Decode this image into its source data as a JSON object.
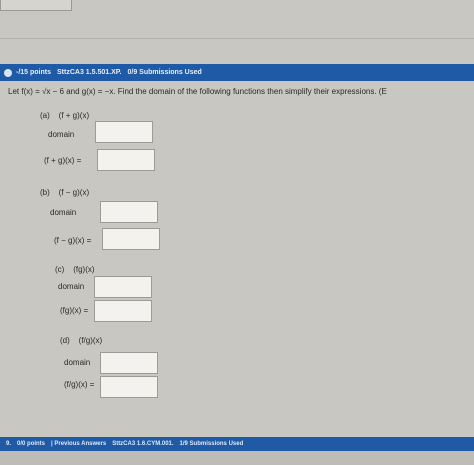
{
  "header": {
    "number": "",
    "points": "-/15 points",
    "code": "SttzCA3 1.5.501.XP.",
    "submissions": "0/9 Submissions Used"
  },
  "question": {
    "statement": "Let f(x) = √x − 6 and g(x) = −x. Find the domain of the following functions then simplify their expressions. (E"
  },
  "parts": [
    {
      "label": "(a)",
      "expr": "(f + g)(x)",
      "domain_label": "domain",
      "value_label": "(f + g)(x) =",
      "domain_value": "",
      "expr_value": ""
    },
    {
      "label": "(b)",
      "expr": "(f − g)(x)",
      "domain_label": "domain",
      "value_label": "(f − g)(x) =",
      "domain_value": "",
      "expr_value": ""
    },
    {
      "label": "(c)",
      "expr": "(fg)(x)",
      "domain_label": "domain",
      "value_label": "(fg)(x) =",
      "domain_value": "",
      "expr_value": ""
    },
    {
      "label": "(d)",
      "expr": "(f/g)(x)",
      "domain_label": "domain",
      "value_label": "(f/g)(x) =",
      "domain_value": "",
      "expr_value": ""
    }
  ],
  "footer": {
    "number": "9.",
    "points": "0/0 points",
    "previous": "| Previous Answers",
    "code": "SttzCA3 1.6.CYM.001.",
    "submissions": "1/9 Submissions Used"
  },
  "colors": {
    "accent": "#1f5aa7"
  }
}
